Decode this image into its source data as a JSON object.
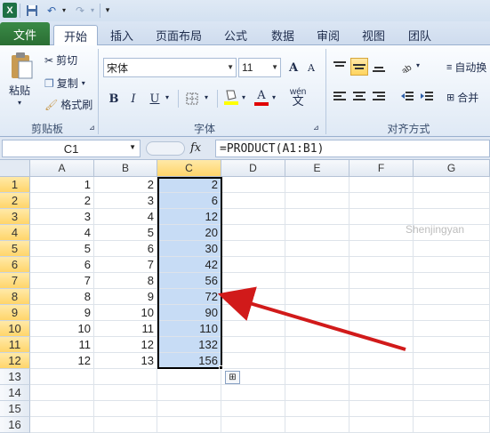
{
  "qat": {
    "app_icon": "X",
    "buttons": [
      "save-icon",
      "undo-icon",
      "redo-icon",
      "customize-icon"
    ]
  },
  "tabs": [
    "文件",
    "开始",
    "插入",
    "页面布局",
    "公式",
    "数据",
    "审阅",
    "视图",
    "团队"
  ],
  "ribbon": {
    "clipboard": {
      "paste": "粘贴",
      "cut": "剪切",
      "copy": "复制",
      "format_painter": "格式刷",
      "group": "剪贴板"
    },
    "font": {
      "name": "宋体",
      "size": "11",
      "group": "字体",
      "bold": "B",
      "italic": "I",
      "underline": "U",
      "grow": "A",
      "shrink": "A",
      "fontcolor": "A",
      "wen": "wén"
    },
    "align": {
      "wrap": "自动换",
      "merge": "合并",
      "group": "对齐方式"
    }
  },
  "formula_bar": {
    "name_box": "C1",
    "fx": "fx",
    "formula": "=PRODUCT(A1:B1)"
  },
  "sheet": {
    "columns": [
      "A",
      "B",
      "C",
      "D",
      "E",
      "F",
      "G"
    ],
    "rows": [
      "1",
      "2",
      "3",
      "4",
      "5",
      "6",
      "7",
      "8",
      "9",
      "10",
      "11",
      "12",
      "13",
      "14",
      "15",
      "16"
    ],
    "data": [
      [
        "1",
        "2",
        "2"
      ],
      [
        "2",
        "3",
        "6"
      ],
      [
        "3",
        "4",
        "12"
      ],
      [
        "4",
        "5",
        "20"
      ],
      [
        "5",
        "6",
        "30"
      ],
      [
        "6",
        "7",
        "42"
      ],
      [
        "7",
        "8",
        "56"
      ],
      [
        "8",
        "9",
        "72"
      ],
      [
        "9",
        "10",
        "90"
      ],
      [
        "10",
        "11",
        "110"
      ],
      [
        "11",
        "12",
        "132"
      ],
      [
        "12",
        "13",
        "156"
      ]
    ]
  },
  "watermark": "Shenjingyan"
}
